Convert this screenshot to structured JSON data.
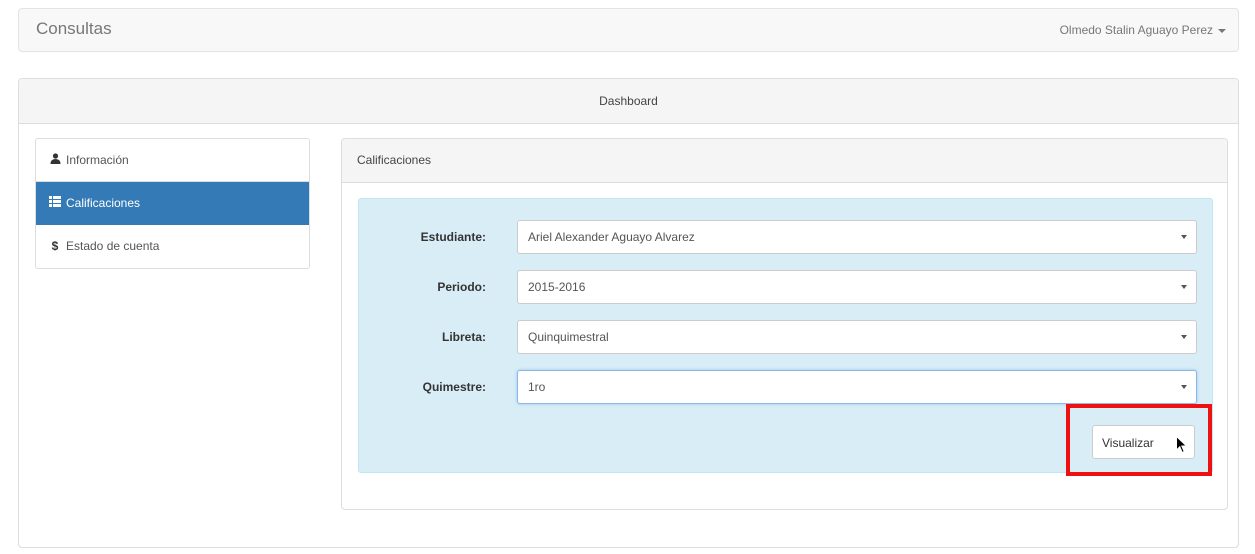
{
  "navbar": {
    "brand": "Consultas",
    "user_name": "Olmedo Stalin Aguayo Perez"
  },
  "dashboard": {
    "title": "Dashboard"
  },
  "sidebar": {
    "items": [
      {
        "icon": "user-icon",
        "label": "Información",
        "active": false
      },
      {
        "icon": "list-icon",
        "label": "Calificaciones",
        "active": true
      },
      {
        "icon": "dollar-icon",
        "label": "Estado de cuenta",
        "active": false
      }
    ]
  },
  "grades_panel": {
    "title": "Calificaciones",
    "fields": [
      {
        "label": "Estudiante:",
        "value": "Ariel Alexander Aguayo Alvarez"
      },
      {
        "label": "Periodo:",
        "value": "2015-2016"
      },
      {
        "label": "Libreta:",
        "value": "Quinquimestral"
      },
      {
        "label": "Quimestre:",
        "value": "1ro"
      }
    ],
    "button_label": "Visualizar"
  },
  "colors": {
    "active_item": "#337ab7",
    "form_background": "#d9edf7",
    "highlight": "#ee1111"
  }
}
